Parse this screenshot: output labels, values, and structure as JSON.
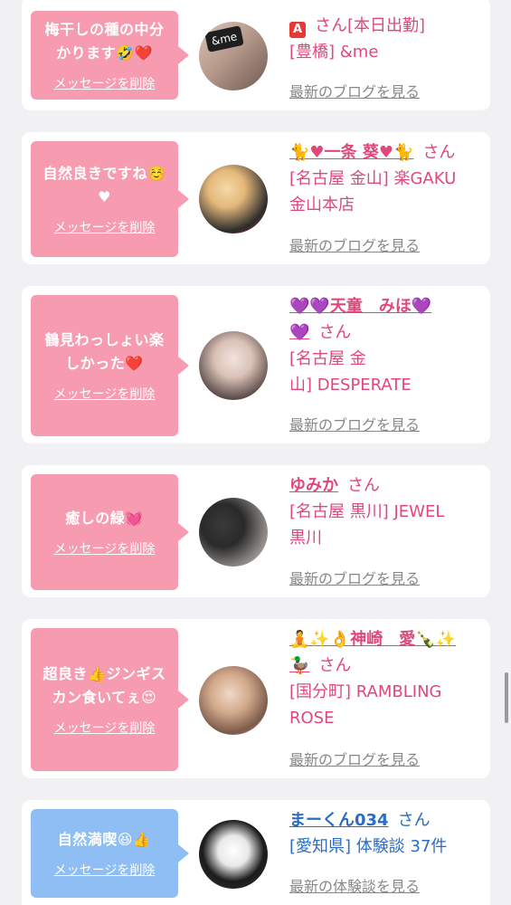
{
  "cards": [
    {
      "message": "梅干しの種の中分\nかります🤣❤️",
      "delete_label": "メッセージを削除",
      "name_prefix": "🅰",
      "name": "",
      "honorific": "さん[本日出勤]",
      "shop": "[豊橋] &me",
      "blog_label": "最新のブログを見る",
      "avatar_text": "&me"
    },
    {
      "message": "自然良きですね☺️\n♥",
      "delete_label": "メッセージを削除",
      "name": "🐈♥一条 葵♥🐈",
      "honorific": "さん",
      "shop": "[名古屋 金山] 楽GAKU\n金山本店",
      "blog_label": "最新のブログを見る"
    },
    {
      "message": "鶴見わっしょい楽\nしかった❤️",
      "delete_label": "メッセージを削除",
      "name": "💜💜天童　みほ💜\n💜",
      "honorific": "さん",
      "shop": "[名古屋 金\n山] DESPERATE",
      "blog_label": "最新のブログを見る"
    },
    {
      "message": "癒しの緑💓",
      "delete_label": "メッセージを削除",
      "name": "ゆみか",
      "honorific": "さん",
      "shop": "[名古屋 黒川] JEWEL\n黒川",
      "blog_label": "最新のブログを見る"
    },
    {
      "message": "超良き👍ジンギス\nカン食いてぇ😍",
      "delete_label": "メッセージを削除",
      "name": "🧘✨👌神崎　愛🍾✨\n🦆",
      "honorific": "さん",
      "shop": "[国分町] RAMBLING\nROSE",
      "blog_label": "最新のブログを見る"
    },
    {
      "message": "自然満喫😆👍",
      "delete_label": "メッセージを削除",
      "name": "まーくん034",
      "honorific": "さん",
      "shop": "[愛知県] 体験談 37件",
      "blog_label": "最新の体験談を見る"
    }
  ],
  "colors": {
    "pink_bubble": "#f79cb0",
    "blue_bubble": "#8fbef4",
    "pink_text": "#e0487a",
    "blue_text": "#2b6cc4",
    "link_gray": "#888888"
  }
}
